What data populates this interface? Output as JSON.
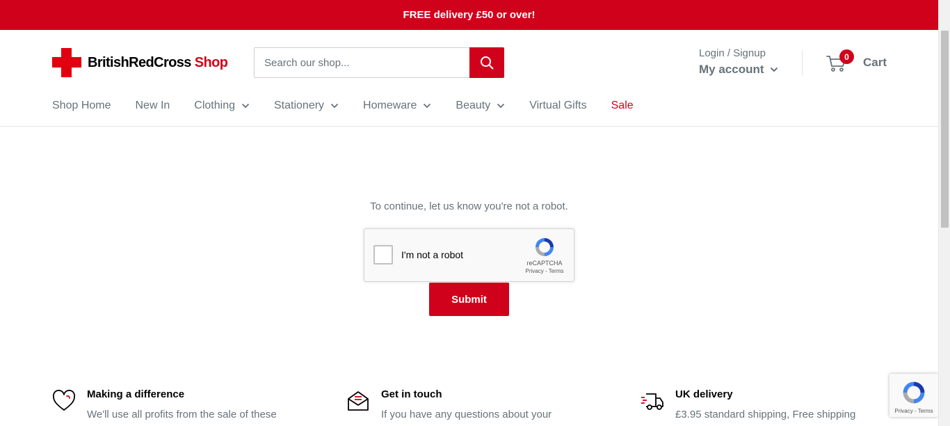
{
  "announcement": "FREE delivery £50 or over!",
  "logo": {
    "name": "BritishRedCross",
    "suffix": "Shop"
  },
  "search": {
    "placeholder": "Search our shop..."
  },
  "account": {
    "login": "Login / Signup",
    "my_account": "My account"
  },
  "cart": {
    "count": "0",
    "label": "Cart"
  },
  "nav": [
    {
      "label": "Shop Home"
    },
    {
      "label": "New In"
    },
    {
      "label": "Clothing"
    },
    {
      "label": "Stationery"
    },
    {
      "label": "Homeware"
    },
    {
      "label": "Beauty"
    },
    {
      "label": "Virtual Gifts"
    },
    {
      "label": "Sale"
    }
  ],
  "captcha": {
    "prompt": "To continue, let us know you're not a robot.",
    "checkbox_label": "I'm not a robot",
    "brand": "reCAPTCHA",
    "links": "Privacy - Terms",
    "submit": "Submit"
  },
  "features": [
    {
      "title": "Making a difference",
      "text": "We'll use all profits from the sale of these",
      "icon": "heart-icon"
    },
    {
      "title": "Get in touch",
      "text": "If you have any questions about your",
      "icon": "envelope-icon"
    },
    {
      "title": "UK delivery",
      "text": "£3.95 standard shipping, Free shipping",
      "icon": "delivery-truck-icon"
    }
  ],
  "recaptcha_badge": {
    "links": "Privacy - Terms"
  },
  "colors": {
    "brand_red": "#d0021b",
    "text_grey": "#677279"
  }
}
